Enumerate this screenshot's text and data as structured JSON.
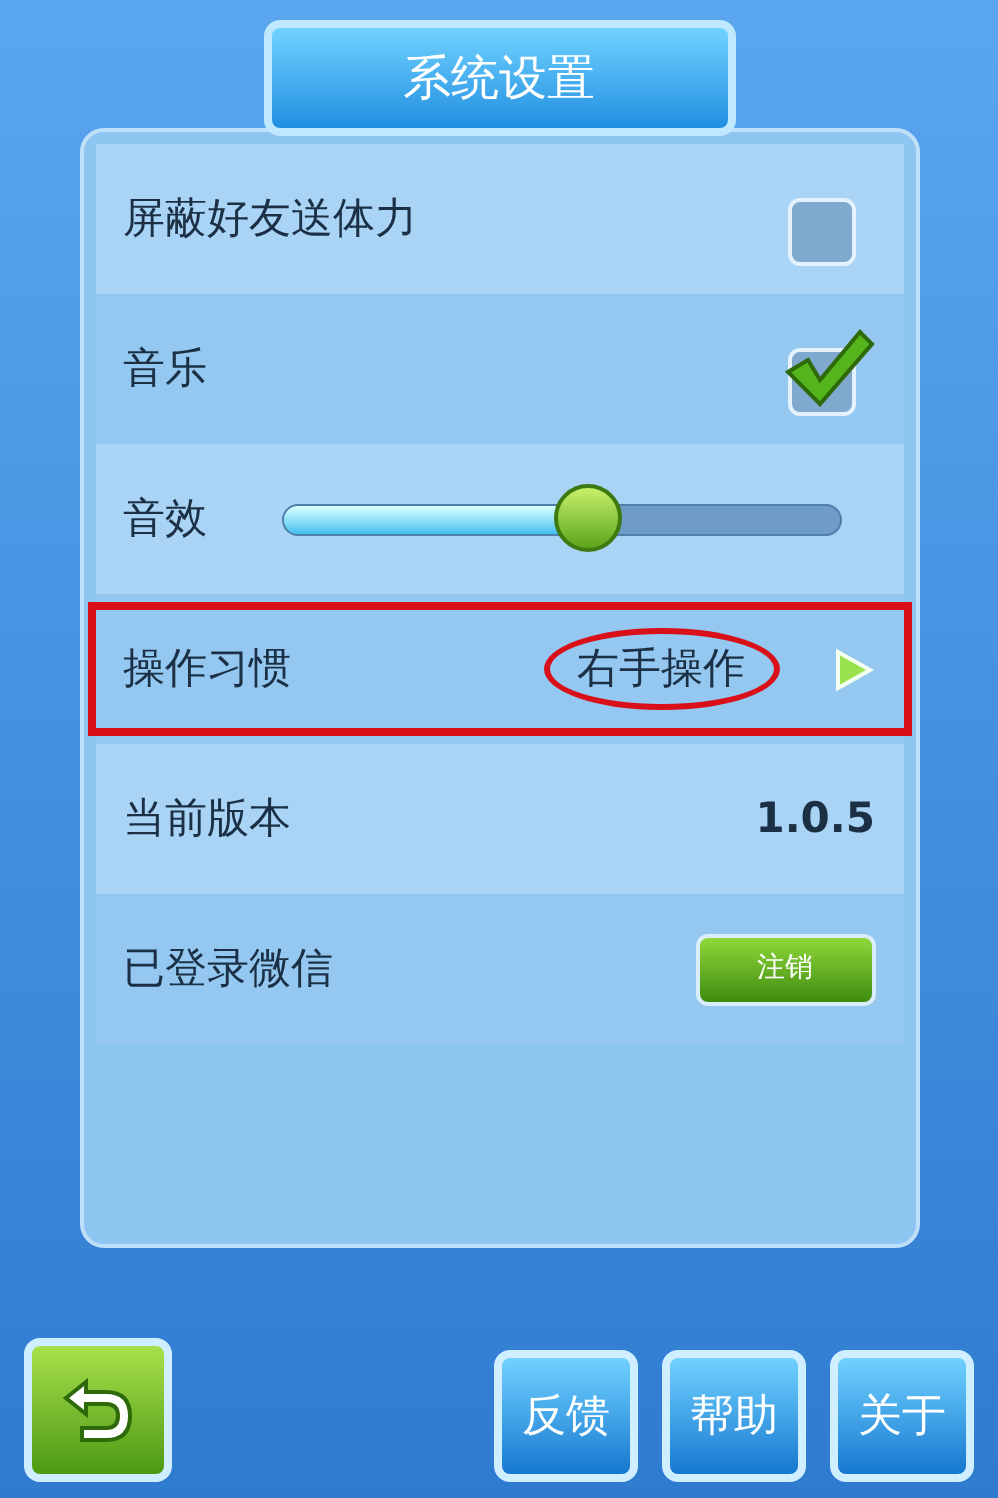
{
  "title": "系统设置",
  "rows": [
    {
      "kind": "checkbox",
      "label": "屏蔽好友送体力",
      "checked": false
    },
    {
      "kind": "checkbox",
      "label": "音乐",
      "checked": true
    },
    {
      "kind": "slider",
      "label": "音效",
      "level": 0.55
    },
    {
      "kind": "option",
      "label": "操作习惯",
      "value": "右手操作",
      "highlighted": true
    },
    {
      "kind": "info",
      "label": "当前版本",
      "value": "1.0.5"
    },
    {
      "kind": "button",
      "label": "已登录微信",
      "button": "注销"
    }
  ],
  "bottom_buttons": [
    "反馈",
    "帮助",
    "关于"
  ]
}
